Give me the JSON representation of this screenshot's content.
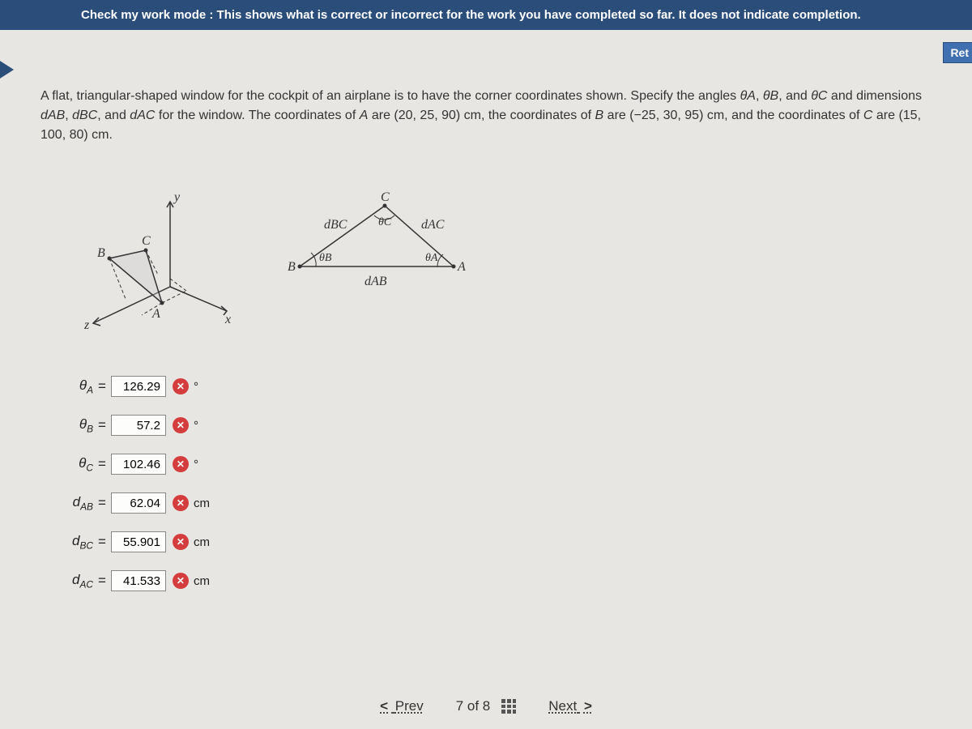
{
  "banner": "Check my work mode : This shows what is correct or incorrect for the work you have completed so far. It does not indicate completion.",
  "ret_badge": "Ret",
  "problem": {
    "line1a": "A flat, triangular-shaped window for the cockpit of an airplane is to have the corner coordinates shown. Specify the angles ",
    "theta_a": "θA",
    "comma1": ", ",
    "theta_b": "θB",
    "comma2": ", and ",
    "theta_c": "θC",
    "line1b": " and dimensions ",
    "dab": "dAB",
    "c3": ", ",
    "dbc": "dBC",
    "c4": ", and ",
    "dac": "dAC",
    "line1c": " for the window. The coordinates of ",
    "A": "A",
    "line1d": " are (20, 25, 90) cm, the coordinates of ",
    "B": "B",
    "line1e": " are (−25, 30, 95) cm, and the coordinates of ",
    "C": "C",
    "line1f": " are (15, 100, 80) cm."
  },
  "figure_labels": {
    "y": "y",
    "x": "x",
    "z": "z",
    "A3d": "A",
    "B3d": "B",
    "C3d": "C",
    "A2d": "A",
    "B2d": "B",
    "C2d": "C",
    "dBC": "dBC",
    "dAC": "dAC",
    "dAB": "dAB",
    "thB": "θB",
    "thC": "θC",
    "thA": "θA"
  },
  "answers": [
    {
      "label_sym": "θ",
      "label_sub": "A",
      "value": "126.29",
      "unit": "°",
      "status": "incorrect"
    },
    {
      "label_sym": "θ",
      "label_sub": "B",
      "value": "57.2",
      "unit": "°",
      "status": "incorrect"
    },
    {
      "label_sym": "θ",
      "label_sub": "C",
      "value": "102.46",
      "unit": "°",
      "status": "incorrect"
    },
    {
      "label_sym": "d",
      "label_sub": "AB",
      "value": "62.04",
      "unit": "cm",
      "status": "incorrect"
    },
    {
      "label_sym": "d",
      "label_sub": "BC",
      "value": "55.901",
      "unit": "cm",
      "status": "incorrect"
    },
    {
      "label_sym": "d",
      "label_sub": "AC",
      "value": "41.533",
      "unit": "cm",
      "status": "incorrect"
    }
  ],
  "nav": {
    "prev": "Prev",
    "position": "7 of 8",
    "next": "Next"
  }
}
